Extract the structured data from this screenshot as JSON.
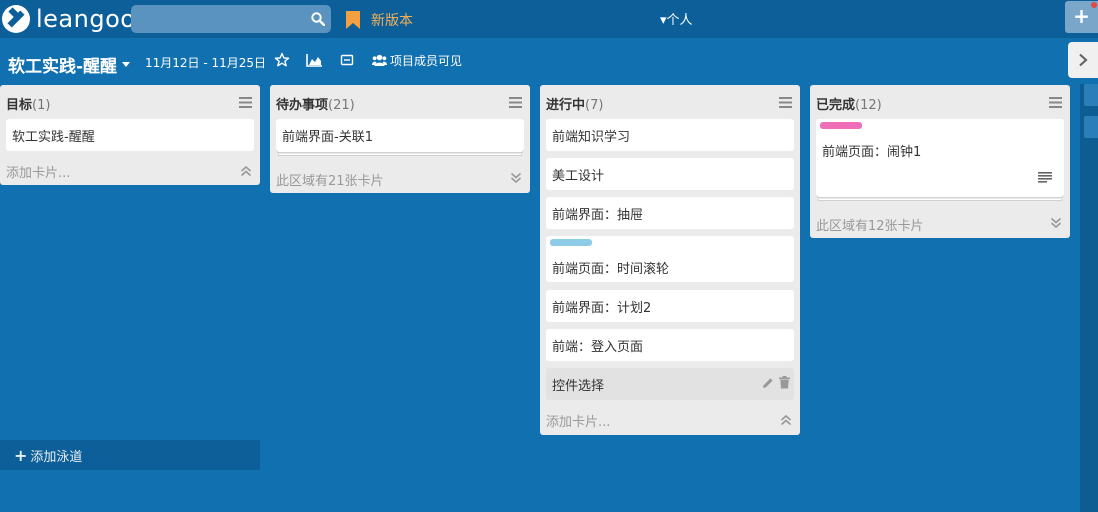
{
  "app": {
    "logo_text": "leangoo"
  },
  "topbar": {
    "search": {
      "value": "",
      "placeholder": ""
    },
    "new_version_label": "新版本",
    "persona_label": "▾个人",
    "add_label": "+"
  },
  "board": {
    "title": "软工实践-醒醒",
    "date_range": "11月12日 - 11月25日",
    "visibility_label": "项目成员可见"
  },
  "lists": [
    {
      "title": "目标",
      "count": "(1)",
      "cards": [
        {
          "text": "软工实践-醒醒"
        }
      ],
      "footer": "添加卡片..."
    },
    {
      "title": "待办事项",
      "count": "(21)",
      "cards": [
        {
          "text": "前端界面-关联1"
        }
      ],
      "footer": "此区域有21张卡片"
    },
    {
      "title": "进行中",
      "count": "(7)",
      "cards": [
        {
          "text": "前端知识学习"
        },
        {
          "text": "美工设计"
        },
        {
          "text": "前端界面：抽屉"
        },
        {
          "text": "前端页面：时间滚轮",
          "label_color": "#8ecbe6"
        },
        {
          "text": "前端界面：计划2"
        },
        {
          "text": "前端：登入页面"
        },
        {
          "text": "控件选择"
        }
      ],
      "footer": "添加卡片..."
    },
    {
      "title": "已完成",
      "count": "(12)",
      "cards": [
        {
          "text": "前端页面：闹钟1",
          "label_color": "#ee6fb7"
        }
      ],
      "footer": "此区域有12张卡片"
    }
  ],
  "add_lane_label": "添加泳道",
  "colors": {
    "board_bg": "#1170b0",
    "topbar_bg": "#0c5f98",
    "new_version": "#f5b05c",
    "list_bg": "#ebebeb"
  }
}
